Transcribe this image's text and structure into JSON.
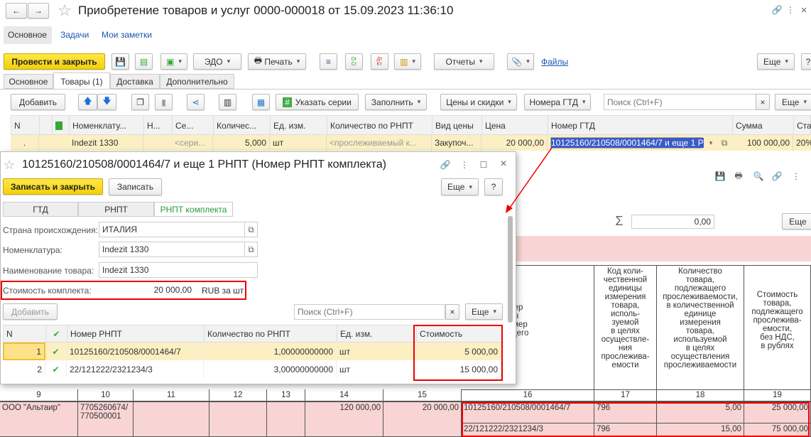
{
  "window": {
    "title": "Приобретение товаров и услуг 0000-000018 от 15.09.2023 11:36:10"
  },
  "nav": {
    "main": "Основное",
    "tasks": "Задачи",
    "notes": "Мои заметки"
  },
  "toolbar": {
    "post_close": "Провести и закрыть",
    "edo": "ЭДО",
    "print": "Печать",
    "reports": "Отчеты",
    "files": "Файлы",
    "more": "Еще"
  },
  "tabs": [
    "Основное",
    "Товары (1)",
    "Доставка",
    "Дополнительно"
  ],
  "goods_toolbar": {
    "add": "Добавить",
    "series": "Указать серии",
    "fill": "Заполнить",
    "prices": "Цены и скидки",
    "gtd": "Номера ГТД",
    "search_placeholder": "Поиск (Ctrl+F)",
    "more": "Еще"
  },
  "goods_table": {
    "headers": [
      "N",
      "",
      "Номенклату...",
      "Н...",
      "Се...",
      "Количес...",
      "Ед. изм.",
      "Количество по РНПТ",
      "Вид цены",
      "Цена",
      "Номер ГТД",
      "Сумма",
      "Ста"
    ],
    "row": {
      "n": ".",
      "item": "Indezit 1330",
      "series": "<сери...",
      "qty": "5,000",
      "unit": "шт",
      "rnpt_qty": "<прослеживаемый к...",
      "price_type": "Закупоч...",
      "price": "20 000,00",
      "gtd": "10125160/210508/0001464/7 и еще 1 Р",
      "sum": "100 000,00",
      "vat": "20%"
    }
  },
  "dialog": {
    "title": "10125160/210508/0001464/7 и еще 1 РНПТ (Номер РНПТ комплекта)",
    "save_close": "Записать и закрыть",
    "save": "Записать",
    "more": "Еще",
    "help": "?",
    "tabs": [
      "ГТД",
      "РНПТ",
      "РНПТ комплекта"
    ],
    "fields": {
      "country_label": "Страна происхождения:",
      "country": "ИТАЛИЯ",
      "item_label": "Номенклатура:",
      "item": "Indezit 1330",
      "name_label": "Наименование товара:",
      "name": "Indezit 1330",
      "cost_label": "Стоимость комплекта:",
      "cost": "20 000,00",
      "cost_unit": "RUB за шт"
    },
    "add": "Добавить",
    "search_placeholder": "Поиск (Ctrl+F)",
    "table": {
      "headers": [
        "N",
        "",
        "Номер РНПТ",
        "Количество по РНПТ",
        "Ед. изм.",
        "Стоимость"
      ],
      "rows": [
        {
          "n": "1",
          "num": "10125160/210508/0001464/7",
          "qty": "1,00000000000",
          "unit": "шт",
          "cost": "5 000,00"
        },
        {
          "n": "2",
          "num": "22/121222/2321234/3",
          "qty": "3,00000000000",
          "unit": "шт",
          "cost": "15 000,00"
        }
      ]
    }
  },
  "report": {
    "sum_value": "0,00",
    "more": "Еще",
    "h16": "ционный номер\nции на товары\nационный номер\nра, подлежащего\nживаемости",
    "h17": "Код коли-\nчественной\nединицы\nизмерения\nтовара,\nисполь-\nзуемой\nв целях\nосуществле-\nния\nпрослежива-\nемости",
    "h18": "Количество\nтовара,\nподлежащего\nпрослеживаемости,\nв количественной\nединице\nизмерения\nтовара,\nиспользуемой\nв целях\nосуществления\nпрослеживаемости",
    "h19": "Стоимость\nтовара,\nподлежащего\nпрослежива-\nемости,\nбез НДС,\nв рублях",
    "col_numbers": [
      "9",
      "10",
      "11",
      "12",
      "13",
      "14",
      "15",
      "16",
      "17",
      "18",
      "19"
    ],
    "seller": "ООО \"Альтаир\"",
    "inn": "7705260674/\n770500001",
    "c14": "120 000,00",
    "c15": "20 000,00",
    "rows": [
      {
        "rnpt": "10125160/210508/0001464/7",
        "code": "796",
        "qty": "5,00",
        "cost": "25 000,00"
      },
      {
        "rnpt": "22/121222/2321234/3",
        "code": "796",
        "qty": "15,00",
        "cost": "75 000,00"
      }
    ]
  }
}
